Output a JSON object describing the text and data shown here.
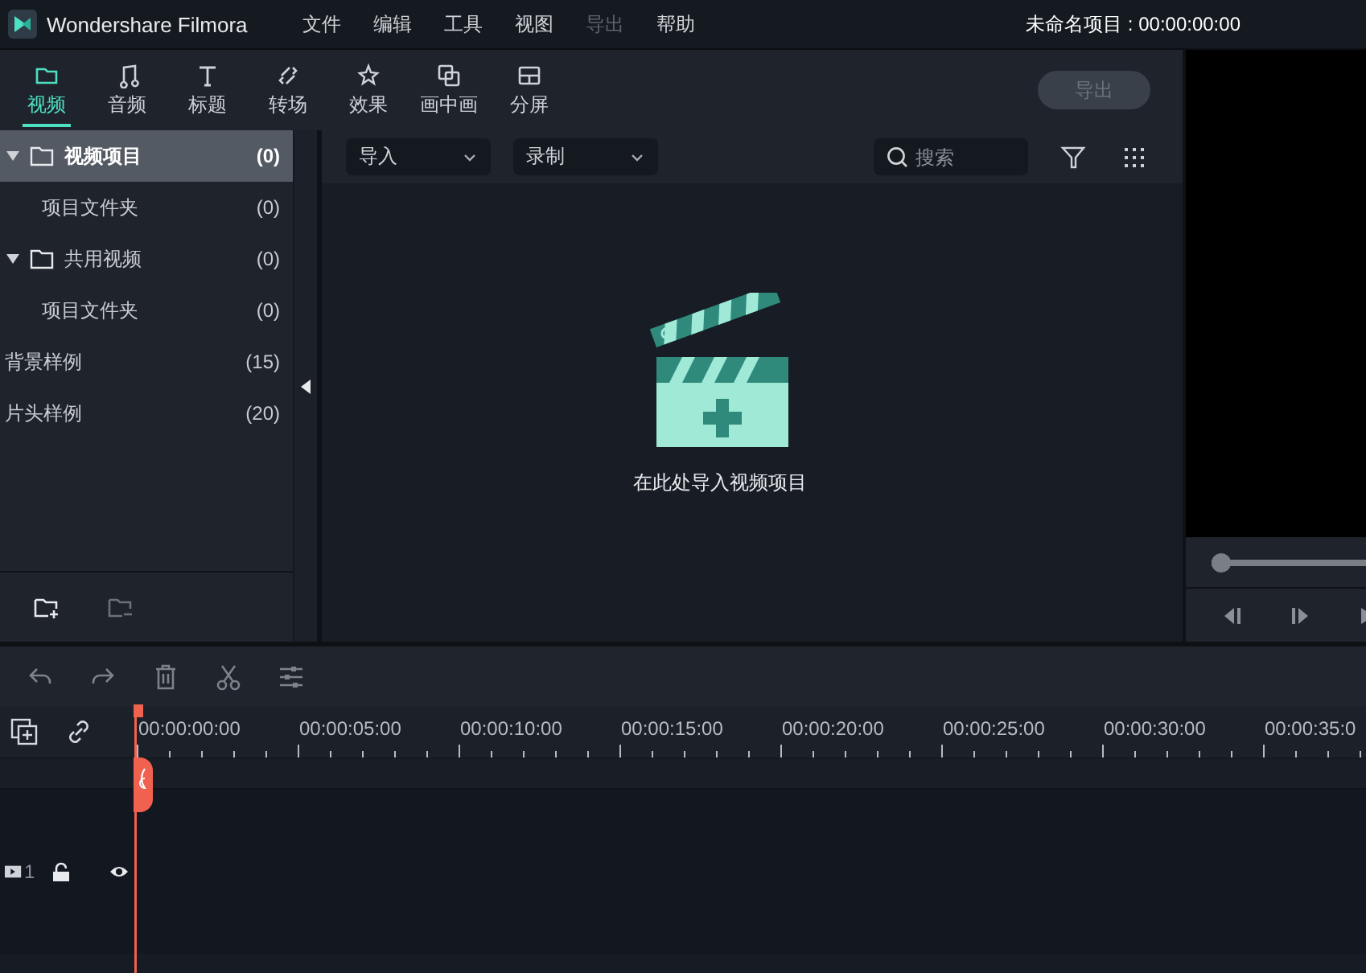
{
  "app": {
    "name": "Wondershare Filmora",
    "project": "未命名项目 : 00:00:00:00"
  },
  "menu": [
    {
      "label": "文件",
      "disabled": false
    },
    {
      "label": "编辑",
      "disabled": false
    },
    {
      "label": "工具",
      "disabled": false
    },
    {
      "label": "视图",
      "disabled": false
    },
    {
      "label": "导出",
      "disabled": true
    },
    {
      "label": "帮助",
      "disabled": false
    }
  ],
  "tabs": [
    {
      "label": "视频",
      "selected": true
    },
    {
      "label": "音频",
      "selected": false
    },
    {
      "label": "标题",
      "selected": false
    },
    {
      "label": "转场",
      "selected": false
    },
    {
      "label": "效果",
      "selected": false
    },
    {
      "label": "画中画",
      "selected": false
    },
    {
      "label": "分屏",
      "selected": false
    }
  ],
  "export_button": {
    "label": "导出",
    "disabled": true
  },
  "library": [
    {
      "label": "视频项目",
      "count": "(0)",
      "selected": true,
      "expanded": true,
      "children": [
        {
          "label": "项目文件夹",
          "count": "(0)",
          "selected": false
        }
      ]
    },
    {
      "label": "共用视频",
      "count": "(0)",
      "selected": false,
      "expanded": true,
      "children": [
        {
          "label": "项目文件夹",
          "count": "(0)",
          "selected": false
        }
      ]
    },
    {
      "label": "背景样例",
      "count": "(15)",
      "selected": false
    },
    {
      "label": "片头样例",
      "count": "(20)",
      "selected": false
    }
  ],
  "media": {
    "dropdowns": [
      "导入",
      "录制"
    ],
    "search": {
      "placeholder": "搜索"
    },
    "empty_text": "在此处导入视频项目"
  },
  "preview": {
    "scrubber": {
      "level": 0
    }
  },
  "timeline": {
    "ruler": [
      "00:00:00:00",
      "00:00:05:00",
      "00:00:10:00",
      "00:00:15:00",
      "00:00:20:00",
      "00:00:25:00",
      "00:00:30:00",
      "00:00:35:0"
    ],
    "tracks": [
      {
        "number": "1",
        "locked": false
      }
    ]
  }
}
